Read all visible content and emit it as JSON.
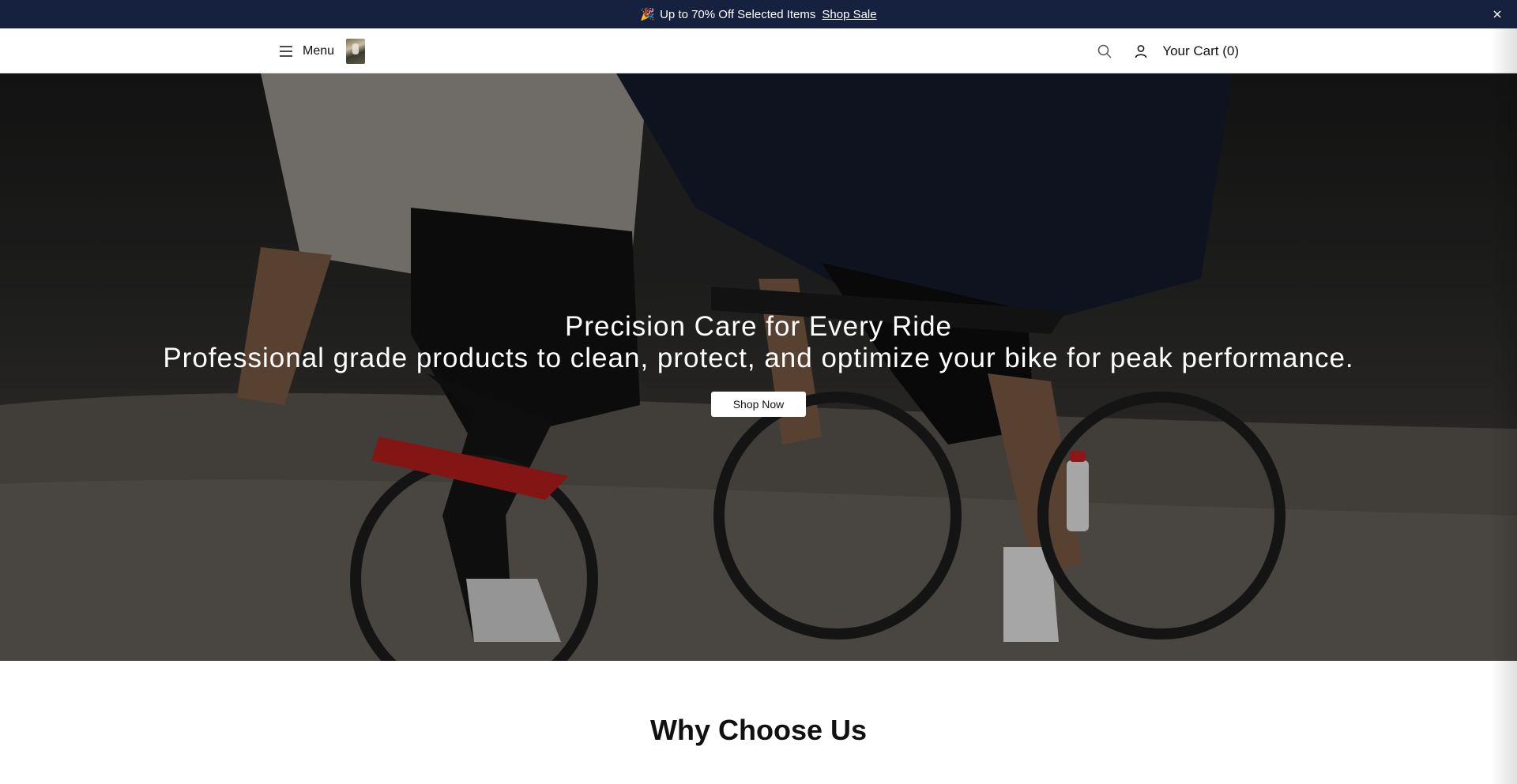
{
  "announcement": {
    "emoji": "🎉",
    "message": "Up to 70% Off Selected Items",
    "link_label": "Shop Sale"
  },
  "header": {
    "menu_label": "Menu",
    "cart_label": "Your Cart (0)"
  },
  "hero": {
    "title": "Precision Care for Every Ride",
    "subtitle": "Professional grade products to clean, protect, and optimize your bike for peak performance.",
    "cta_label": "Shop Now"
  },
  "section": {
    "heading": "Why Choose Us"
  },
  "icons": [
    "close-icon",
    "hamburger-icon",
    "search-icon",
    "user-icon"
  ],
  "colors": {
    "announcement_bg": "#15213f",
    "header_bg": "#ffffff",
    "cta_bg": "#ffffff"
  }
}
